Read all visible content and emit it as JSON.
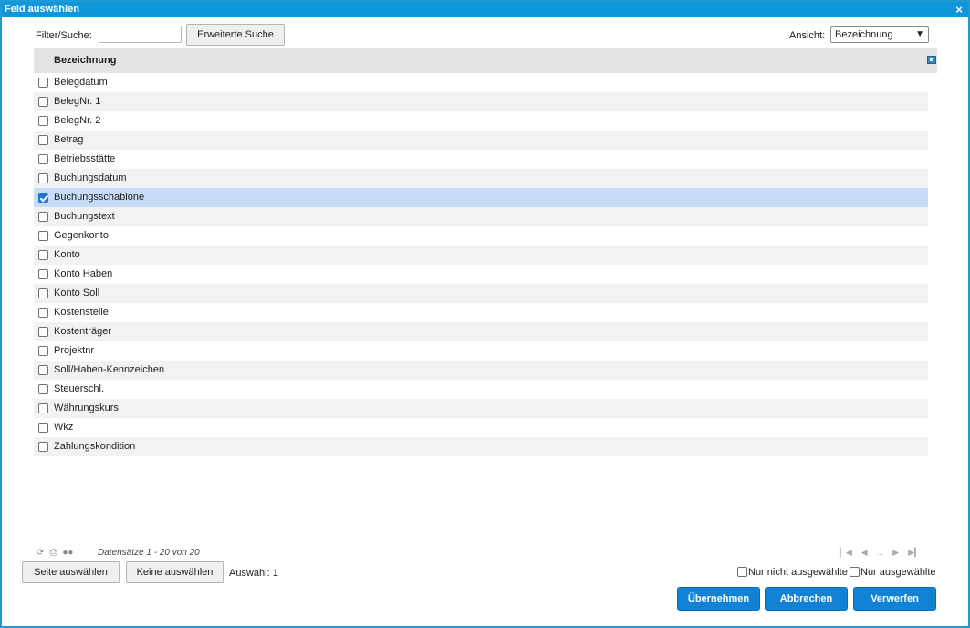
{
  "dialog": {
    "title": "Feld auswählen",
    "close_label": "×"
  },
  "filter": {
    "label": "Filter/Suche:",
    "value": "",
    "advanced_search_label": "Erweiterte Suche"
  },
  "view": {
    "label": "Ansicht:",
    "selected": "Bezeichnung"
  },
  "grid": {
    "column_header": "Bezeichnung",
    "rows": [
      {
        "label": "Belegdatum",
        "checked": false
      },
      {
        "label": "BelegNr. 1",
        "checked": false
      },
      {
        "label": "BelegNr. 2",
        "checked": false
      },
      {
        "label": "Betrag",
        "checked": false
      },
      {
        "label": "Betriebsstätte",
        "checked": false
      },
      {
        "label": "Buchungsdatum",
        "checked": false
      },
      {
        "label": "Buchungsschablone",
        "checked": true
      },
      {
        "label": "Buchungstext",
        "checked": false
      },
      {
        "label": "Gegenkonto",
        "checked": false
      },
      {
        "label": "Konto",
        "checked": false
      },
      {
        "label": "Konto Haben",
        "checked": false
      },
      {
        "label": "Konto Soll",
        "checked": false
      },
      {
        "label": "Kostenstelle",
        "checked": false
      },
      {
        "label": "Kostenträger",
        "checked": false
      },
      {
        "label": "Projektnr",
        "checked": false
      },
      {
        "label": "Soll/Haben-Kennzeichen",
        "checked": false
      },
      {
        "label": "Steuerschl.",
        "checked": false
      },
      {
        "label": "Währungskurs",
        "checked": false
      },
      {
        "label": "Wkz",
        "checked": false
      },
      {
        "label": "Zahlungskondition",
        "checked": false
      }
    ]
  },
  "pager": {
    "records_text": "Datensätze 1 - 20 von 20",
    "ellipsis": "..."
  },
  "footer": {
    "select_page_label": "Seite auswählen",
    "select_none_label": "Keine auswählen",
    "selection_count": "Auswahl: 1",
    "only_unselected_label": "Nur nicht ausgewählte",
    "only_selected_label": "Nur ausgewählte",
    "apply_label": "Übernehmen",
    "cancel_label": "Abbrechen",
    "discard_label": "Verwerfen"
  },
  "colors": {
    "titlebar": "#0f97d9",
    "primary_button": "#1283d4",
    "selected_row": "#c6dcf7"
  }
}
